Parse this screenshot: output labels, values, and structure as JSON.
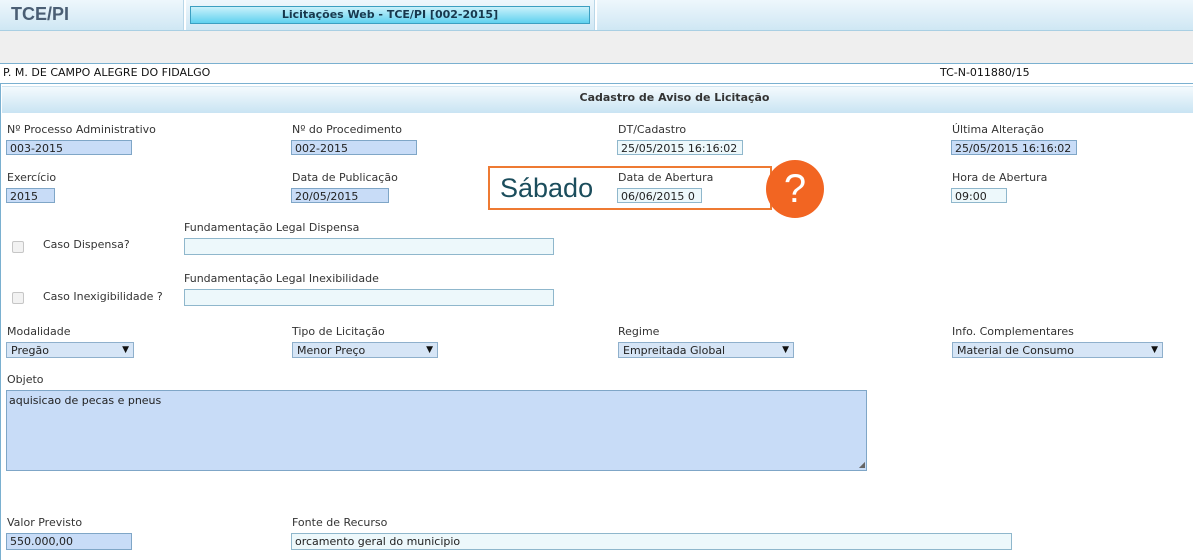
{
  "header": {
    "logo": "TCE/PI",
    "app_title": "Licitações Web - TCE/PI  [002-2015]"
  },
  "org": {
    "name": "P. M. DE CAMPO ALEGRE DO FIDALGO",
    "code": "TC-N-011880/15"
  },
  "section_title": "Cadastro de Aviso de Licitação",
  "fields": {
    "processo_adm": {
      "label": "Nº Processo Administrativo",
      "value": "003-2015"
    },
    "procedimento": {
      "label": "Nº do Procedimento",
      "value": "002-2015"
    },
    "dt_cadastro": {
      "label": "DT/Cadastro",
      "value": "25/05/2015 16:16:02"
    },
    "ultima_alteracao": {
      "label": "Última Alteração",
      "value": "25/05/2015 16:16:02"
    },
    "exercicio": {
      "label": "Exercício",
      "value": "2015"
    },
    "data_publicacao": {
      "label": "Data de Publicação",
      "value": "20/05/2015"
    },
    "data_abertura": {
      "label": "Data de Abertura",
      "value": "06/06/2015 0"
    },
    "hora_abertura": {
      "label": "Hora de Abertura",
      "value": "09:00"
    },
    "fund_dispensa": {
      "label": "Fundamentação Legal Dispensa",
      "value": ""
    },
    "caso_dispensa": {
      "label": "Caso Dispensa?"
    },
    "fund_inexig": {
      "label": "Fundamentação Legal Inexibilidade",
      "value": ""
    },
    "caso_inexig": {
      "label": "Caso Inexigibilidade ?"
    },
    "modalidade": {
      "label": "Modalidade",
      "value": "Pregão"
    },
    "tipo_licitacao": {
      "label": "Tipo de Licitação",
      "value": "Menor Preço"
    },
    "regime": {
      "label": "Regime",
      "value": "Empreitada Global"
    },
    "info_compl": {
      "label": "Info. Complementares",
      "value": "Material de Consumo"
    },
    "objeto": {
      "label": "Objeto",
      "value": "aquisicao de pecas e pneus"
    },
    "valor_previsto": {
      "label": "Valor Previsto",
      "value": "550.000,00"
    },
    "fonte_recurso": {
      "label": "Fonte de Recurso",
      "value": "orcamento geral do municipio"
    }
  },
  "annotation": {
    "text": "Sábado",
    "icon": "?"
  }
}
